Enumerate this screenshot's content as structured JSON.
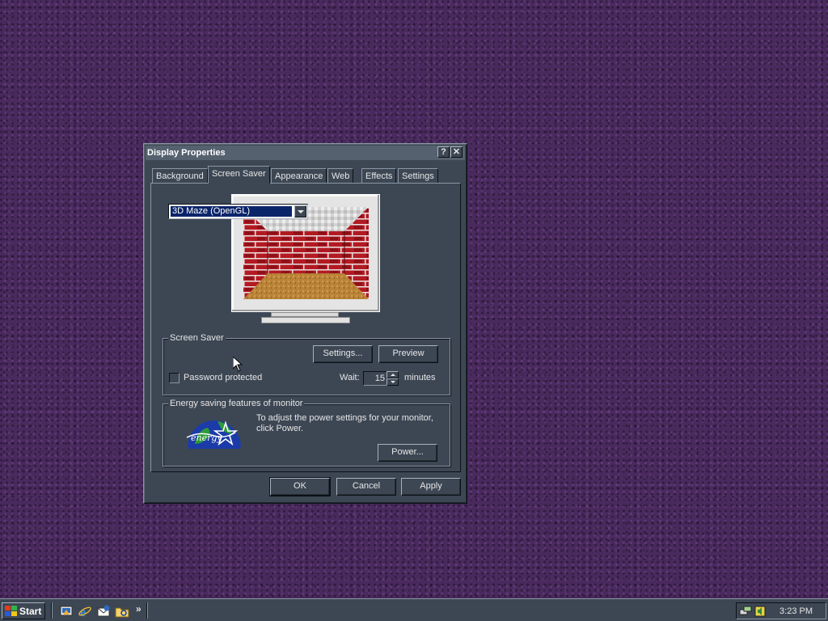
{
  "window": {
    "title": "Display Properties",
    "help_label": "?",
    "close_label": "✕"
  },
  "tabs": [
    {
      "label": "Background"
    },
    {
      "label": "Screen Saver",
      "active": true
    },
    {
      "label": "Appearance"
    },
    {
      "label": "Web"
    },
    {
      "label": "Effects"
    },
    {
      "label": "Settings"
    }
  ],
  "screen_saver": {
    "group_label": "Screen Saver",
    "selected": "3D Maze (OpenGL)",
    "settings_button": "Settings...",
    "preview_button": "Preview",
    "password_label": "Password protected",
    "password_checked": false,
    "wait_label": "Wait:",
    "wait_value": "15",
    "wait_unit": "minutes"
  },
  "energy": {
    "group_label": "Energy saving features of monitor",
    "description": "To adjust the power settings for your monitor, click Power.",
    "power_button": "Power...",
    "logo_text": "energy"
  },
  "dialog_buttons": {
    "ok": "OK",
    "cancel": "Cancel",
    "apply": "Apply"
  },
  "taskbar": {
    "start_label": "Start",
    "quick_launch": [
      "show-desktop-icon",
      "internet-explorer-icon",
      "outlook-express-icon",
      "windows-explorer-icon"
    ],
    "overflow": "»",
    "clock": "3:23 PM"
  },
  "colors": {
    "desktop": "#4a2a5e",
    "window_face": "#3d4754",
    "title_bar": "#55616e",
    "selection": "#0a246a",
    "text": "#e6e6e6"
  }
}
